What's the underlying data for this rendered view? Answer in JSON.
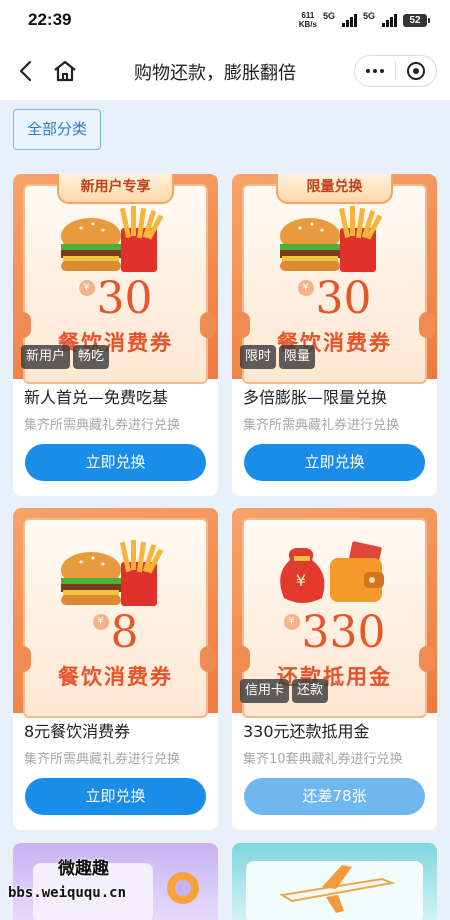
{
  "status_bar": {
    "time": "22:39",
    "net_speed_top": "611",
    "net_speed_unit": "KB/s",
    "sim1": "5G",
    "sim2": "5G",
    "battery": "52"
  },
  "title_bar": {
    "title": "购物还款，膨胀翻倍"
  },
  "category_button": "全部分类",
  "cards": [
    {
      "ribbon": "新用户专享",
      "price": "30",
      "coupon_name": "餐饮消费券",
      "tags": [
        "新用户",
        "畅吃"
      ],
      "title": "新人首兑—免费吃基",
      "subtitle": "集齐所需典藏礼券进行兑换",
      "button": "立即兑换",
      "image": "burger-fries"
    },
    {
      "ribbon": "限量兑换",
      "price": "30",
      "coupon_name": "餐饮消费券",
      "tags": [
        "限时",
        "限量"
      ],
      "title": "多倍膨胀—限量兑换",
      "subtitle": "集齐所需典藏礼券进行兑换",
      "button": "立即兑换",
      "image": "burger-fries"
    },
    {
      "ribbon": "",
      "price": "8",
      "coupon_name": "餐饮消费券",
      "tags": [],
      "title": "8元餐饮消费券",
      "subtitle": "集齐所需典藏礼券进行兑换",
      "button": "立即兑换",
      "image": "burger-fries"
    },
    {
      "ribbon": "",
      "price": "330",
      "coupon_name": "还款抵用金",
      "tags": [
        "信用卡",
        "还款"
      ],
      "title": "330元还款抵用金",
      "subtitle": "集齐10套典藏礼券进行兑换",
      "button": "还差78张",
      "image": "money-bag-wallet"
    }
  ],
  "watermark": {
    "line1": "微趣趣",
    "line2": "bbs.weiququ.cn"
  },
  "colors": {
    "primary_button": "#1a8de9",
    "disabled_button": "#6fb8ef",
    "coupon_orange": "#ee7a3e",
    "background": "#e8f1fb"
  }
}
